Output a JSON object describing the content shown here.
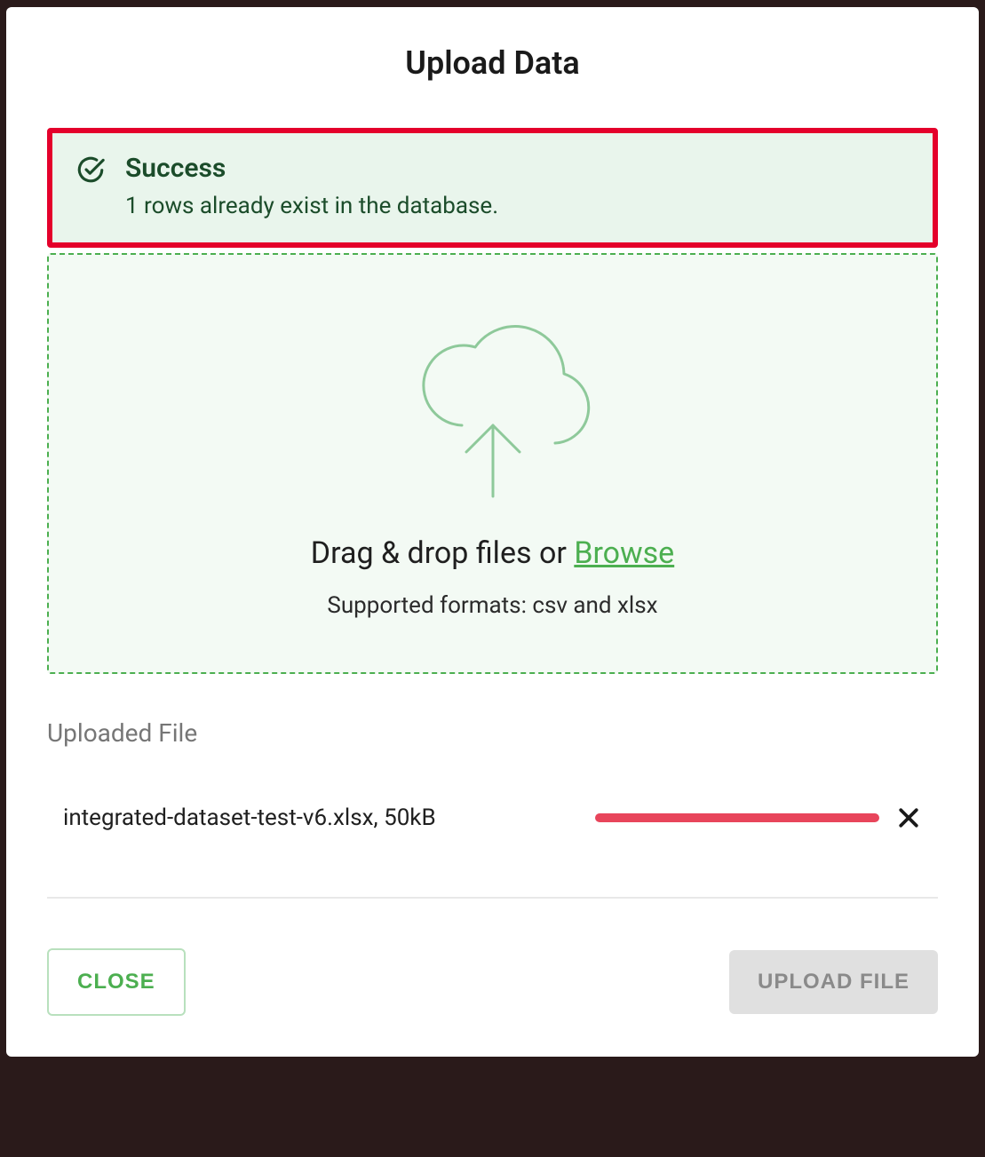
{
  "dialog": {
    "title": "Upload Data"
  },
  "alert": {
    "title": "Success",
    "message": "1 rows already exist in the database."
  },
  "dropzone": {
    "prompt_prefix": "Drag & drop files or ",
    "browse_label": "Browse",
    "supported_label": "Supported formats: csv and xlsx"
  },
  "uploaded": {
    "section_label": "Uploaded File",
    "file_label": "integrated-dataset-test-v6.xlsx, 50kB",
    "progress_color": "#e8455b"
  },
  "buttons": {
    "close_label": "CLOSE",
    "upload_label": "UPLOAD FILE"
  }
}
